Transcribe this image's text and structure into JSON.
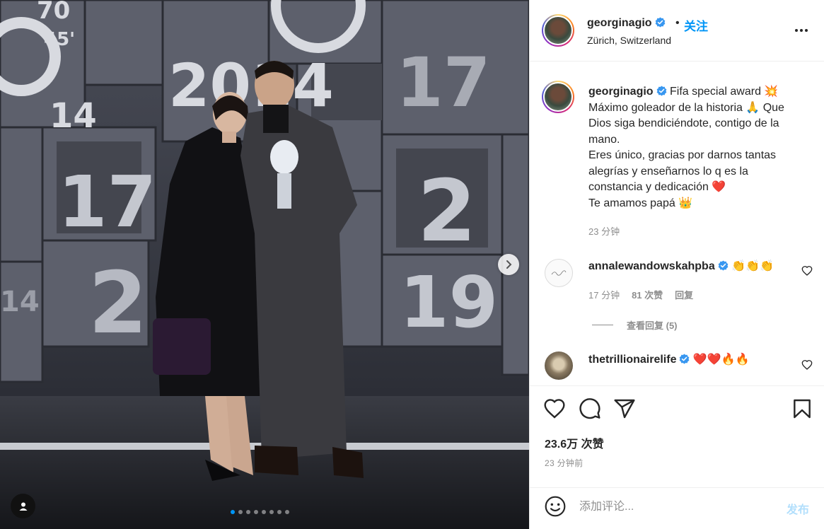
{
  "post": {
    "author": "georginagio",
    "follow_dot": "•",
    "follow_label": "关注",
    "location": "Zürich, Switzerland",
    "caption_lines": [
      "Fifa special award 💥",
      "Máximo goleador de la historia 🙏 Que",
      "Dios siga bendiciéndote, contigo de la",
      "mano.",
      "Eres único, gracias por darnos tantas",
      "alegrías y enseñarnos lo q es la",
      "constancia y dedicación ❤️",
      "Te amamos papá 👑"
    ],
    "caption_time": "23 分钟",
    "likes": "23.6万 次赞",
    "time_ago": "23 分钟前"
  },
  "photo": {
    "slide_count": 8,
    "active_slide": 1,
    "board_numbers": [
      "70",
      "45'",
      "2014",
      "14",
      "17",
      "17",
      "2",
      "2",
      "19",
      "14"
    ]
  },
  "comments": [
    {
      "user": "annalewandowskahpba",
      "text": "👏👏👏",
      "time": "17 分钟",
      "likes": "81 次赞",
      "reply": "回复",
      "view_replies": "查看回复 (5)"
    },
    {
      "user": "thetrillionairelife",
      "text": "❤️❤️🔥🔥"
    }
  ],
  "comment_box": {
    "placeholder": "添加评论...",
    "post_label": "发布"
  },
  "icons": {
    "verified": "verified-badge-icon",
    "more": "more-options-icon",
    "like": "heart-icon",
    "comment": "comment-icon",
    "share": "share-icon",
    "save": "bookmark-icon",
    "emoji": "emoji-icon",
    "user_tag": "user-tag-icon",
    "next": "chevron-right-icon"
  },
  "colors": {
    "accent": "#0095f6",
    "verified": "#3897f0",
    "post_disabled": "#b2dffc"
  }
}
